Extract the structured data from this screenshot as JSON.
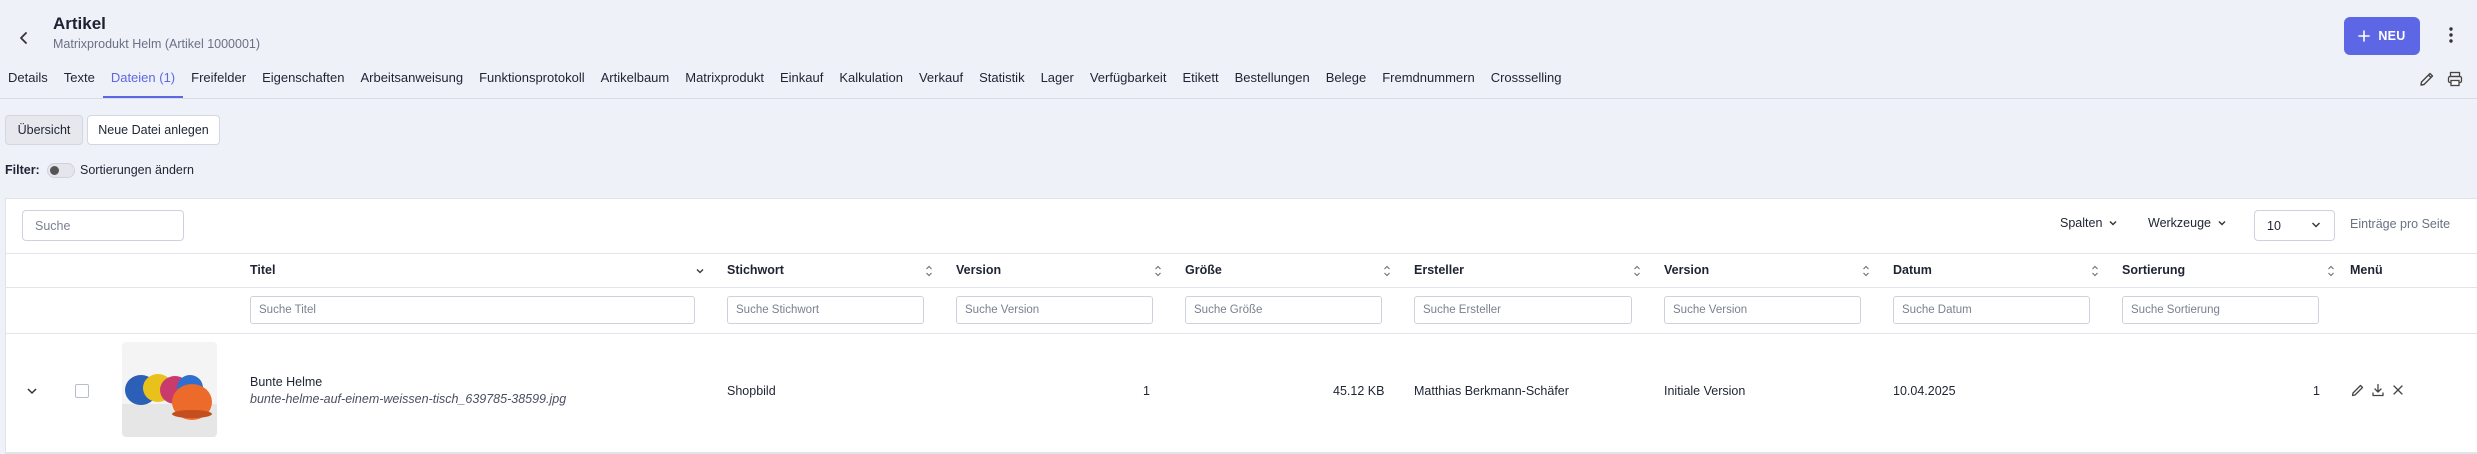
{
  "header": {
    "title": "Artikel",
    "subtitle": "Matrixprodukt Helm (Artikel 1000001)",
    "new_label": "NEU"
  },
  "tabs": [
    {
      "label": "Details"
    },
    {
      "label": "Texte"
    },
    {
      "label": "Dateien (1)",
      "active": true
    },
    {
      "label": "Freifelder"
    },
    {
      "label": "Eigenschaften"
    },
    {
      "label": "Arbeitsanweisung"
    },
    {
      "label": "Funktionsprotokoll"
    },
    {
      "label": "Artikelbaum"
    },
    {
      "label": "Matrixprodukt"
    },
    {
      "label": "Einkauf"
    },
    {
      "label": "Kalkulation"
    },
    {
      "label": "Verkauf"
    },
    {
      "label": "Statistik"
    },
    {
      "label": "Lager"
    },
    {
      "label": "Verfügbarkeit"
    },
    {
      "label": "Etikett"
    },
    {
      "label": "Bestellungen"
    },
    {
      "label": "Belege"
    },
    {
      "label": "Fremdnummern"
    },
    {
      "label": "Crossselling"
    }
  ],
  "actions": {
    "overview_label": "Übersicht",
    "new_file_label": "Neue Datei anlegen"
  },
  "filter": {
    "label": "Filter:",
    "toggle_label": "Sortierungen ändern",
    "toggle_on": false
  },
  "toolbar": {
    "search_placeholder": "Suche",
    "columns_label": "Spalten",
    "tools_label": "Werkzeuge",
    "per_page_value": "10",
    "per_page_label": "Einträge pro Seite"
  },
  "table": {
    "headers": {
      "titel": "Titel",
      "stichwort": "Stichwort",
      "version": "Version",
      "groesse": "Größe",
      "ersteller": "Ersteller",
      "version2": "Version",
      "datum": "Datum",
      "sortierung": "Sortierung",
      "menu": "Menü"
    },
    "filters": {
      "titel": "Suche Titel",
      "stichwort": "Suche Stichwort",
      "version": "Suche Version",
      "groesse": "Suche Größe",
      "ersteller": "Suche Ersteller",
      "version2": "Suche Version",
      "datum": "Suche Datum",
      "sortierung": "Suche Sortierung"
    },
    "rows": [
      {
        "title": "Bunte Helme",
        "filename": "bunte-helme-auf-einem-weissen-tisch_639785-38599.jpg",
        "stichwort": "Shopbild",
        "version": "1",
        "groesse": "45.12 KB",
        "ersteller": "Matthias Berkmann-Schäfer",
        "version_text": "Initiale Version",
        "datum": "10.04.2025",
        "sortierung": "1"
      }
    ]
  },
  "colors": {
    "accent": "#5d67e6",
    "background": "#eff1f8"
  }
}
